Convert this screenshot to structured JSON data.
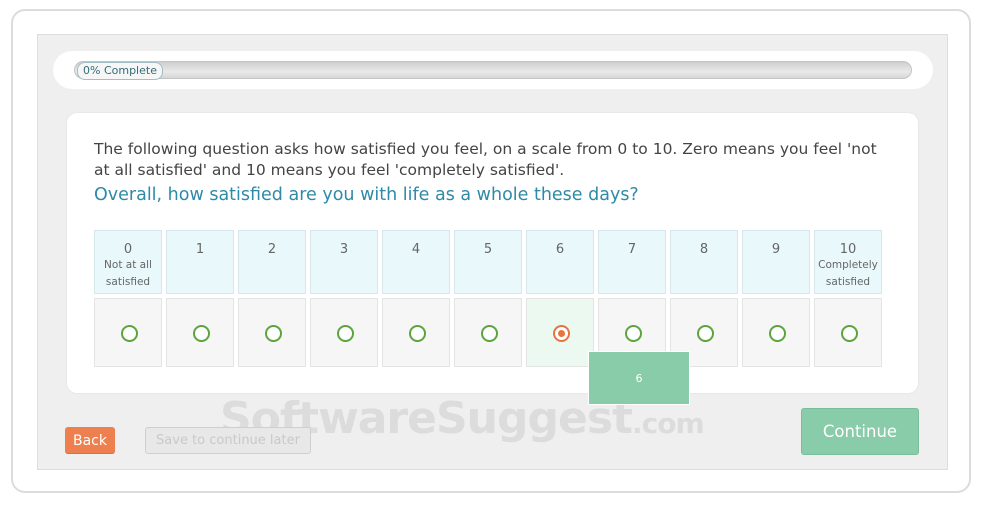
{
  "progress": {
    "label": "0% Complete",
    "percent": 0
  },
  "survey": {
    "intro": "The following question asks how satisfied you feel, on a scale from 0 to 10. Zero means you feel 'not at all satisfied' and 10 means you feel 'completely satisfied'.",
    "question": "Overall, how satisfied are you with life as a whole these days?",
    "scale": [
      {
        "value": "0",
        "sub_lines": [
          "Not at all",
          "satisfied"
        ]
      },
      {
        "value": "1",
        "sub_lines": []
      },
      {
        "value": "2",
        "sub_lines": []
      },
      {
        "value": "3",
        "sub_lines": []
      },
      {
        "value": "4",
        "sub_lines": []
      },
      {
        "value": "5",
        "sub_lines": []
      },
      {
        "value": "6",
        "sub_lines": []
      },
      {
        "value": "7",
        "sub_lines": []
      },
      {
        "value": "8",
        "sub_lines": []
      },
      {
        "value": "9",
        "sub_lines": []
      },
      {
        "value": "10",
        "sub_lines": [
          "Completely",
          "satisfied"
        ]
      }
    ],
    "selected": "6",
    "tooltip": "6"
  },
  "buttons": {
    "back": "Back",
    "save": "Save to continue later",
    "continue": "Continue"
  },
  "watermark": {
    "main": "SoftwareSuggest",
    "suffix": ".com"
  },
  "colors": {
    "accent_green": "#88cca9",
    "radio_green": "#5aa63c",
    "selected_orange": "#e8733f",
    "back_orange": "#ee7f4f",
    "question_blue": "#2e8aa8",
    "header_cell": "#e9f8fb"
  }
}
